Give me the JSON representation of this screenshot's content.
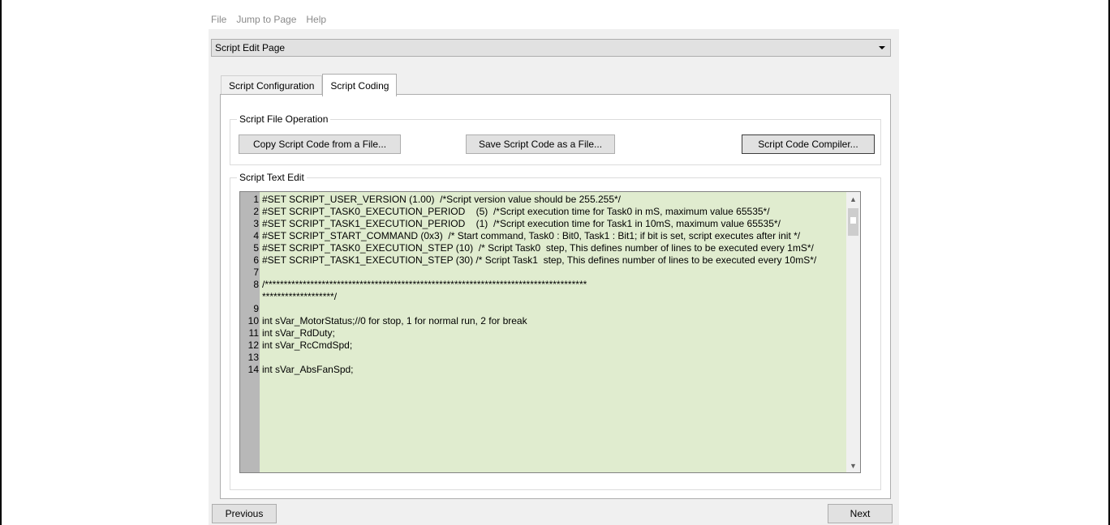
{
  "menu": {
    "items": [
      "File",
      "Jump to Page",
      "Help"
    ]
  },
  "page_selector": {
    "value": "Script Edit Page"
  },
  "tabs": [
    {
      "label": "Script Configuration",
      "active": false
    },
    {
      "label": "Script Coding",
      "active": true
    }
  ],
  "file_operation": {
    "title": "Script File Operation",
    "copy_label": "Copy Script Code from a File...",
    "save_label": "Save Script Code as a File...",
    "compiler_label": "Script Code Compiler..."
  },
  "text_edit": {
    "title": "Script Text Edit",
    "lines": [
      {
        "num": "1",
        "code": "#SET SCRIPT_USER_VERSION (1.00)  /*Script version value should be 255.255*/"
      },
      {
        "num": "2",
        "code": "#SET SCRIPT_TASK0_EXECUTION_PERIOD    (5)  /*Script execution time for Task0 in mS, maximum value 65535*/"
      },
      {
        "num": "3",
        "code": "#SET SCRIPT_TASK1_EXECUTION_PERIOD    (1)  /*Script execution time for Task1 in 10mS, maximum value 65535*/"
      },
      {
        "num": "4",
        "code": "#SET SCRIPT_START_COMMAND (0x3)  /* Start command, Task0 : Bit0, Task1 : Bit1; if bit is set, script executes after init */"
      },
      {
        "num": "5",
        "code": "#SET SCRIPT_TASK0_EXECUTION_STEP (10)  /* Script Task0  step, This defines number of lines to be executed every 1mS*/"
      },
      {
        "num": "6",
        "code": "#SET SCRIPT_TASK1_EXECUTION_STEP (30) /* Script Task1  step, This defines number of lines to be executed every 10mS*/"
      },
      {
        "num": "7",
        "code": ""
      },
      {
        "num": "8",
        "code": "/*************************************************************************************\n*******************/"
      },
      {
        "num": "9",
        "code": ""
      },
      {
        "num": "10",
        "code": "int sVar_MotorStatus;//0 for stop, 1 for normal run, 2 for break"
      },
      {
        "num": "11",
        "code": "int sVar_RdDuty;"
      },
      {
        "num": "12",
        "code": "int sVar_RcCmdSpd;"
      },
      {
        "num": "13",
        "code": ""
      },
      {
        "num": "14",
        "code": "int sVar_AbsFanSpd;"
      }
    ]
  },
  "navigation": {
    "previous_label": "Previous",
    "next_label": "Next"
  }
}
